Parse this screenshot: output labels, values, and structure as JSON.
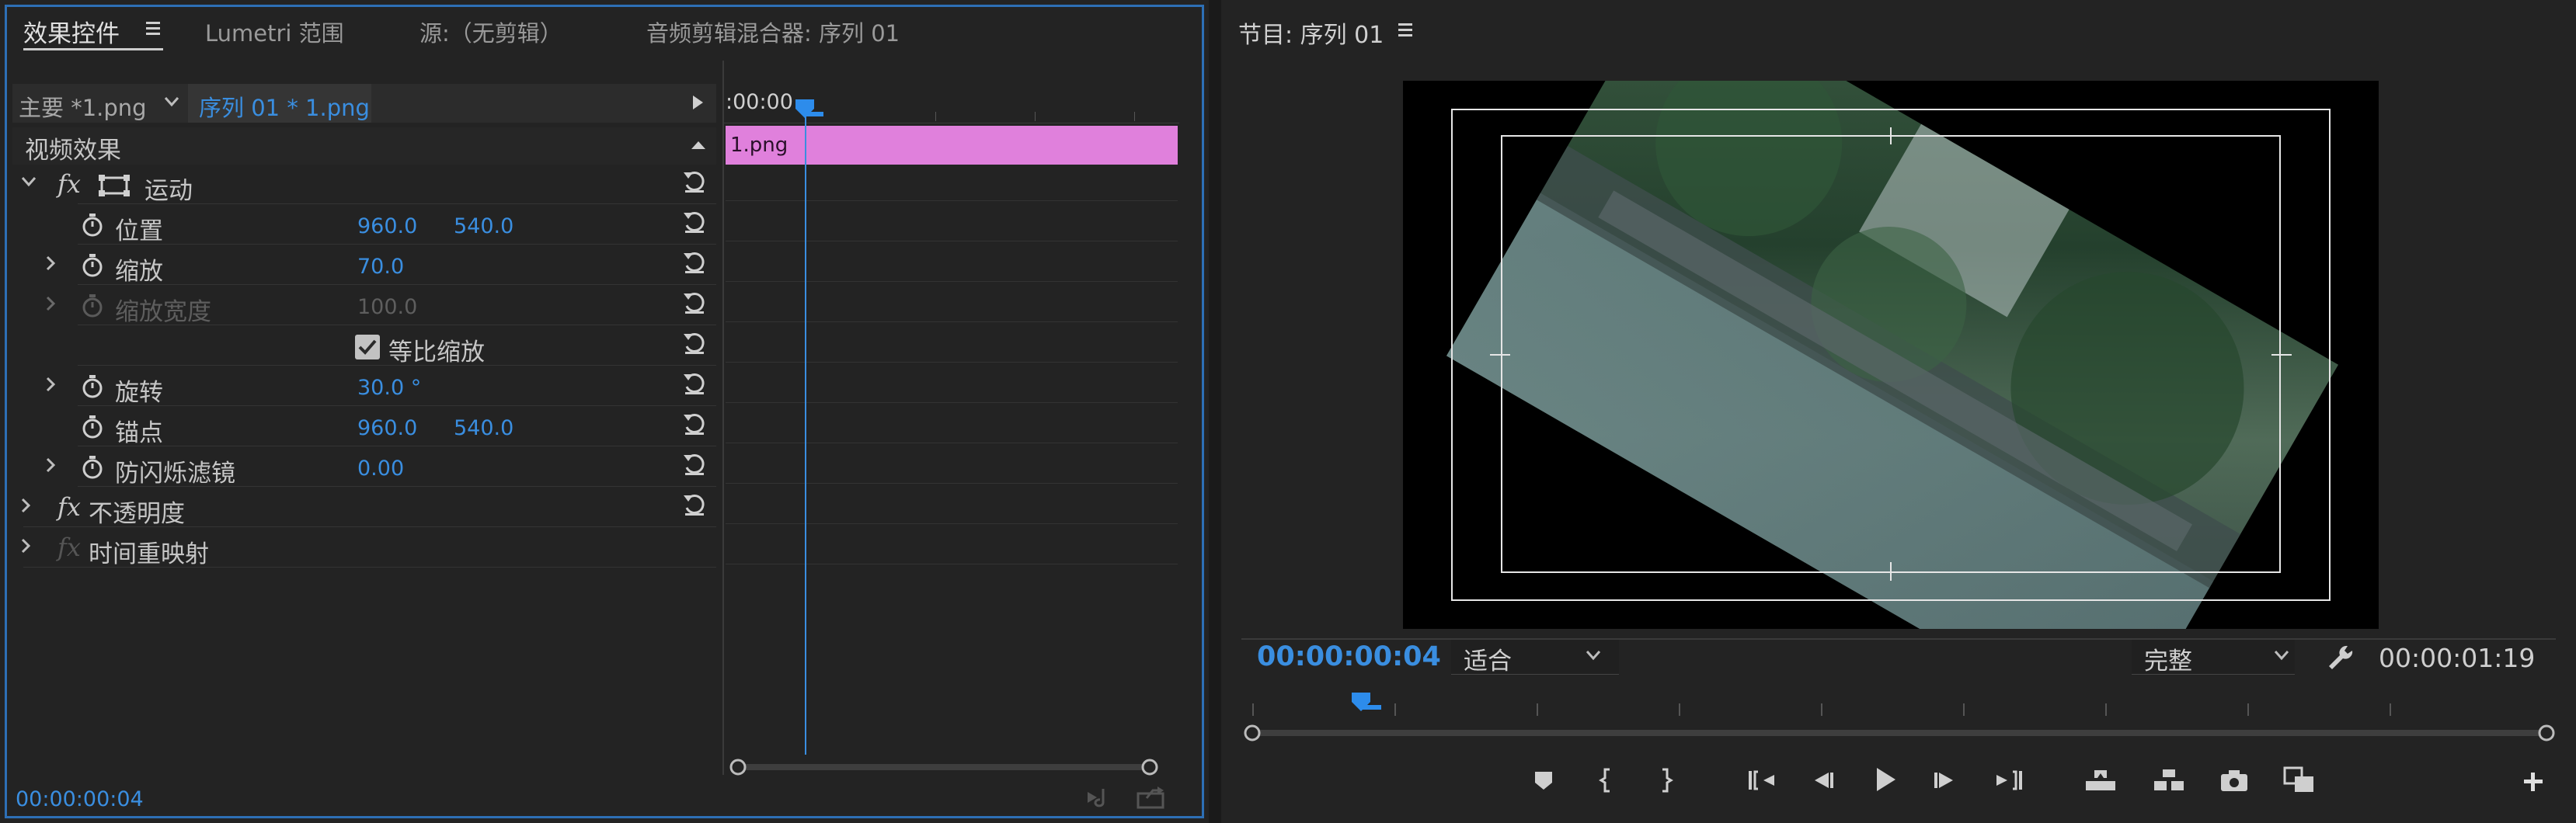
{
  "effect_controls": {
    "tabs": {
      "effect_controls": "效果控件",
      "lumetri": "Lumetri 范围",
      "source": "源:（无剪辑）",
      "audio_mixer": "音频剪辑混合器: 序列 01"
    },
    "header": {
      "master": "主要 *1.png",
      "sequence": "序列 01 * 1.png"
    },
    "section_title": "视频效果",
    "motion": {
      "label": "运动",
      "properties": [
        {
          "label": "位置",
          "v1": "960.0",
          "v2": "540.0"
        },
        {
          "label": "缩放",
          "v1": "70.0",
          "v2": ""
        },
        {
          "label": "缩放宽度",
          "v1": "100.0",
          "v2": ""
        },
        {
          "label": "等比缩放",
          "v1": "",
          "v2": ""
        },
        {
          "label": "旋转",
          "v1": "30.0 °",
          "v2": ""
        },
        {
          "label": "锚点",
          "v1": "960.0",
          "v2": "540.0"
        },
        {
          "label": "防闪烁滤镜",
          "v1": "0.00",
          "v2": ""
        }
      ]
    },
    "opacity_label": "不透明度",
    "time_remap_label": "时间重映射",
    "timeline": {
      "start_time": ":00:00",
      "clip_name": "1.png",
      "clip_color": "#e080dc"
    },
    "current_time": "00:00:00:04"
  },
  "program_monitor": {
    "title": "节目: 序列 01",
    "current_time": "00:00:00:04",
    "fit_label": "适合",
    "quality_label": "完整",
    "duration": "00:00:01:19"
  },
  "colors": {
    "accent": "#2d8ceb",
    "panel_border": "#2d6fb5",
    "panel_bg": "#232323"
  }
}
